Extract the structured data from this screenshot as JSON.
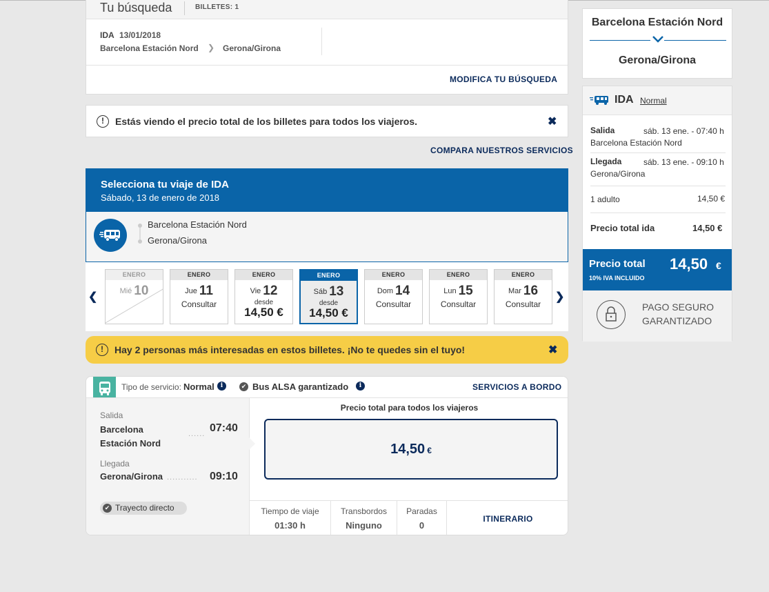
{
  "search": {
    "title": "Tu búsqueda",
    "tickets": "BILLETES: 1",
    "ida_label": "IDA",
    "date": "13/01/2018",
    "from": "Barcelona Estación Nord",
    "to": "Gerona/Girona",
    "modify": "MODIFICA TU BÚSQUEDA"
  },
  "info_bar": {
    "text": "Estás viendo el precio total de los billetes para todos los viajeros."
  },
  "compare": "COMPARA NUESTROS SERVICIOS",
  "select": {
    "title": "Selecciona tu viaje de IDA",
    "date": "Sábado, 13 de enero de 2018",
    "from": "Barcelona Estación Nord",
    "to": "Gerona/Girona"
  },
  "days": [
    {
      "month": "ENERO",
      "weekday": "Mié",
      "day": "10",
      "state": "disabled"
    },
    {
      "month": "ENERO",
      "weekday": "Jue",
      "day": "11",
      "consult": "Consultar"
    },
    {
      "month": "ENERO",
      "weekday": "Vie",
      "day": "12",
      "desde": "desde",
      "price": "14,50 €"
    },
    {
      "month": "ENERO",
      "weekday": "Sáb",
      "day": "13",
      "desde": "desde",
      "price": "14,50 €",
      "state": "selected"
    },
    {
      "month": "ENERO",
      "weekday": "Dom",
      "day": "14",
      "consult": "Consultar"
    },
    {
      "month": "ENERO",
      "weekday": "Lun",
      "day": "15",
      "consult": "Consultar"
    },
    {
      "month": "ENERO",
      "weekday": "Mar",
      "day": "16",
      "consult": "Consultar"
    }
  ],
  "warning": {
    "text": "Hay 2 personas más interesadas en estos billetes. ¡No te quedes sin el tuyo!"
  },
  "trip": {
    "service_label": "Tipo de servicio:",
    "service_value": "Normal",
    "guarantee": "Bus ALSA garantizado",
    "onboard": "SERVICIOS A BORDO",
    "dep_label": "Salida",
    "dep_place": "Barcelona Estación Nord",
    "dep_time": "07:40",
    "arr_label": "Llegada",
    "arr_place": "Gerona/Girona",
    "arr_time": "09:10",
    "direct": "Trayecto directo",
    "total_label": "Precio total para todos los viajeros",
    "price": "14,50",
    "currency": "€",
    "stats": [
      {
        "label": "Tiempo de viaje",
        "value": "01:30 h"
      },
      {
        "label": "Transbordos",
        "value": "Ninguno"
      },
      {
        "label": "Paradas",
        "value": "0"
      }
    ],
    "itinerary": "ITINERARIO"
  },
  "summary": {
    "from": "Barcelona Estación Nord",
    "to": "Gerona/Girona",
    "ida": "IDA",
    "normal": "Normal",
    "dep_label": "Salida",
    "dep_time": "sáb. 13 ene. - 07:40 h",
    "dep_place": "Barcelona Estación Nord",
    "arr_label": "Llegada",
    "arr_time": "sáb. 13 ene. - 09:10 h",
    "arr_place": "Gerona/Girona",
    "adult": "1 adulto",
    "adult_price": "14,50 €",
    "total_ida_label": "Precio total ida",
    "total_ida": "14,50 €",
    "total_label": "Precio total",
    "total": "14,50",
    "currency": "€",
    "iva": "10% IVA INCLUIDO",
    "secure_1": "PAGO SEGURO",
    "secure_2": "GARANTIZADO"
  },
  "colors": {
    "brand_blue": "#0a64a8",
    "navy": "#0b2a5b",
    "warning_yellow": "#f6cd46",
    "bus_green": "#49b3a1"
  },
  "icons": [
    "info-icon",
    "close-icon",
    "bus-icon",
    "chevron-left-icon",
    "chevron-right-icon",
    "check-icon",
    "lock-icon",
    "chevron-down-icon"
  ]
}
